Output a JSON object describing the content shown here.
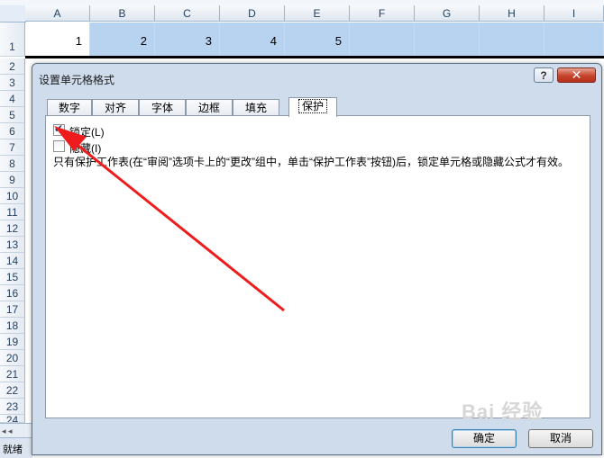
{
  "columns": [
    "A",
    "B",
    "C",
    "D",
    "E",
    "F",
    "G",
    "H",
    "I"
  ],
  "rows": [
    "1",
    "2",
    "3",
    "4",
    "5",
    "6",
    "7",
    "8",
    "9",
    "10",
    "11",
    "12",
    "13",
    "14",
    "15",
    "16",
    "17",
    "18",
    "19",
    "20",
    "21",
    "22",
    "23",
    "24"
  ],
  "row1_values": [
    "1",
    "2",
    "3",
    "4",
    "5"
  ],
  "status": {
    "ready": "就绪"
  },
  "nav": {
    "arrows": "◂ ◂"
  },
  "dialog": {
    "title": "设置单元格格式",
    "help": "?",
    "close": "✕",
    "tabs": [
      {
        "label": "数字"
      },
      {
        "label": "对齐"
      },
      {
        "label": "字体"
      },
      {
        "label": "边框"
      },
      {
        "label": "填充"
      },
      {
        "label": "保护"
      }
    ],
    "active_tab": "保护",
    "locked": {
      "label": "锁定(L)",
      "checked": true
    },
    "hidden": {
      "label": "隐藏(I)",
      "checked": false
    },
    "description": "只有保护工作表(在“审阅”选项卡上的“更改”组中，单击“保护工作表”按钮)后，锁定单元格或隐藏公式才有效。",
    "ok": "确定",
    "cancel": "取消"
  },
  "watermark": "Bai 经验",
  "colors": {
    "arrow": "#ee1c1c",
    "selection": "#b8d3f0",
    "dialog_bg": "#cfdcec"
  }
}
